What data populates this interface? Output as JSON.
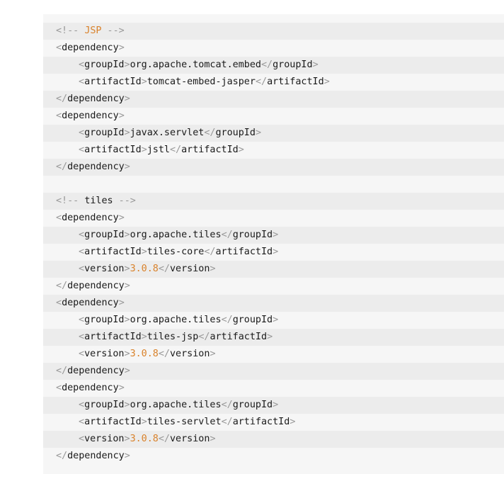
{
  "code": {
    "lines": [
      {
        "kind": "comment",
        "indent": 0,
        "text": "JSP"
      },
      {
        "kind": "open",
        "indent": 0,
        "tag": "dependency"
      },
      {
        "kind": "elem",
        "indent": 1,
        "tag": "groupId",
        "value": "org.apache.tomcat.embed",
        "num": false
      },
      {
        "kind": "elem",
        "indent": 1,
        "tag": "artifactId",
        "value": "tomcat-embed-jasper",
        "num": false
      },
      {
        "kind": "close",
        "indent": 0,
        "tag": "dependency"
      },
      {
        "kind": "open",
        "indent": 0,
        "tag": "dependency"
      },
      {
        "kind": "elem",
        "indent": 1,
        "tag": "groupId",
        "value": "javax.servlet",
        "num": false
      },
      {
        "kind": "elem",
        "indent": 1,
        "tag": "artifactId",
        "value": "jstl",
        "num": false
      },
      {
        "kind": "close",
        "indent": 0,
        "tag": "dependency"
      },
      {
        "kind": "blank",
        "indent": 0
      },
      {
        "kind": "comment",
        "indent": 0,
        "text": "tiles"
      },
      {
        "kind": "open",
        "indent": 0,
        "tag": "dependency"
      },
      {
        "kind": "elem",
        "indent": 1,
        "tag": "groupId",
        "value": "org.apache.tiles",
        "num": false
      },
      {
        "kind": "elem",
        "indent": 1,
        "tag": "artifactId",
        "value": "tiles-core",
        "num": false
      },
      {
        "kind": "elem",
        "indent": 1,
        "tag": "version",
        "value": "3.0.8",
        "num": true
      },
      {
        "kind": "close",
        "indent": 0,
        "tag": "dependency"
      },
      {
        "kind": "open",
        "indent": 0,
        "tag": "dependency"
      },
      {
        "kind": "elem",
        "indent": 1,
        "tag": "groupId",
        "value": "org.apache.tiles",
        "num": false
      },
      {
        "kind": "elem",
        "indent": 1,
        "tag": "artifactId",
        "value": "tiles-jsp",
        "num": false
      },
      {
        "kind": "elem",
        "indent": 1,
        "tag": "version",
        "value": "3.0.8",
        "num": true
      },
      {
        "kind": "close",
        "indent": 0,
        "tag": "dependency"
      },
      {
        "kind": "open",
        "indent": 0,
        "tag": "dependency"
      },
      {
        "kind": "elem",
        "indent": 1,
        "tag": "groupId",
        "value": "org.apache.tiles",
        "num": false
      },
      {
        "kind": "elem",
        "indent": 1,
        "tag": "artifactId",
        "value": "tiles-servlet",
        "num": false
      },
      {
        "kind": "elem",
        "indent": 1,
        "tag": "version",
        "value": "3.0.8",
        "num": true
      },
      {
        "kind": "close",
        "indent": 0,
        "tag": "dependency"
      }
    ]
  },
  "colors": {
    "background": "#f6f6f6",
    "stripe": "#ececec",
    "punctuation": "#999999",
    "number": "#d9822b",
    "text": "#1a1a1a"
  }
}
